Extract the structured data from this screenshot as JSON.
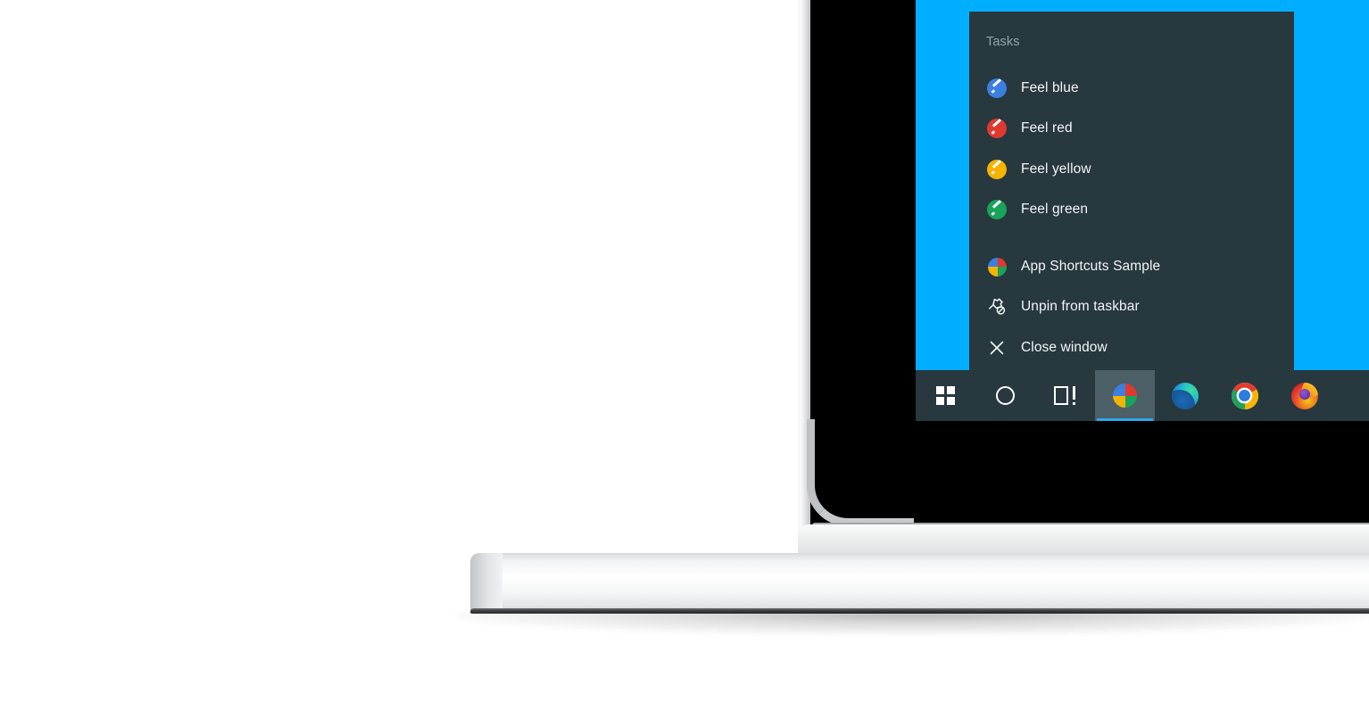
{
  "scene": {
    "description": "Windows 10 taskbar jump list shown on a laptop screen",
    "wallpaper_color": "#00aeff",
    "bezel_color": "#000000",
    "chassis_color": "#e6e7e9"
  },
  "jumplist": {
    "background_color": "#27383f",
    "title": "Tasks",
    "title_color": "#97a3a8",
    "tasks": [
      {
        "label": "Feel blue",
        "icon": "brush-icon",
        "color": "#3c7fe0"
      },
      {
        "label": "Feel red",
        "icon": "brush-icon",
        "color": "#e03a2f"
      },
      {
        "label": "Feel yellow",
        "icon": "brush-icon",
        "color": "#f5b400"
      },
      {
        "label": "Feel green",
        "icon": "brush-icon",
        "color": "#1aa35a"
      }
    ],
    "actions": [
      {
        "label": "App Shortcuts Sample",
        "icon": "app-quadrant-icon"
      },
      {
        "label": "Unpin from taskbar",
        "icon": "unpin-icon"
      },
      {
        "label": "Close window",
        "icon": "close-icon"
      }
    ],
    "app_icon_colors": {
      "top_left": "#3c7fe0",
      "top_right": "#e03a2f",
      "bottom_left": "#f5b400",
      "bottom_right": "#1aa35a"
    }
  },
  "taskbar": {
    "background_color": "#27383f",
    "active_highlight_color": "#4d5f66",
    "active_underline_color": "#2fa8e8",
    "buttons": [
      {
        "name": "start",
        "icon": "windows-logo-icon",
        "label": "Start",
        "active": false
      },
      {
        "name": "cortana",
        "icon": "cortana-circle-icon",
        "label": "Cortana",
        "active": false
      },
      {
        "name": "task-view",
        "icon": "task-view-icon",
        "label": "Task View",
        "active": false
      },
      {
        "name": "app-sample",
        "icon": "app-quadrant-icon",
        "label": "App Shortcuts Sample",
        "active": true
      },
      {
        "name": "edge",
        "icon": "edge-icon",
        "label": "Microsoft Edge",
        "active": false
      },
      {
        "name": "chrome",
        "icon": "chrome-icon",
        "label": "Google Chrome",
        "active": false
      },
      {
        "name": "firefox",
        "icon": "firefox-icon",
        "label": "Mozilla Firefox",
        "active": false
      }
    ]
  }
}
